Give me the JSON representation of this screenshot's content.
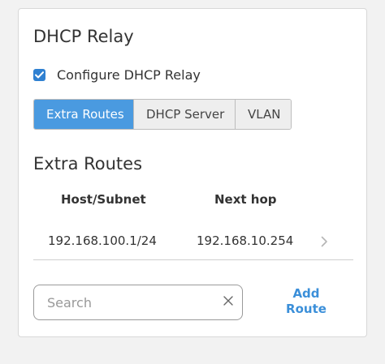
{
  "panel": {
    "title": "DHCP Relay",
    "configure_checkbox": {
      "label": "Configure DHCP Relay",
      "checked": true
    },
    "tabs": [
      {
        "label": "Extra Routes",
        "active": true
      },
      {
        "label": "DHCP Server",
        "active": false
      },
      {
        "label": "VLAN",
        "active": false
      }
    ]
  },
  "extra_routes": {
    "title": "Extra Routes",
    "columns": [
      "Host/Subnet",
      "Next hop"
    ],
    "rows": [
      {
        "host_subnet": "192.168.100.1/24",
        "next_hop": "192.168.10.254"
      }
    ]
  },
  "search": {
    "value": "",
    "placeholder": "Search"
  },
  "add_route": {
    "line1": "Add",
    "line2": "Route"
  },
  "colors": {
    "accent": "#4a9ae0",
    "link": "#3b8fd9",
    "checkbox": "#2f80d1"
  },
  "icons": {
    "checkbox": "checkmark-icon",
    "row_chevron": "chevron-right-icon",
    "search_clear": "close-icon"
  }
}
